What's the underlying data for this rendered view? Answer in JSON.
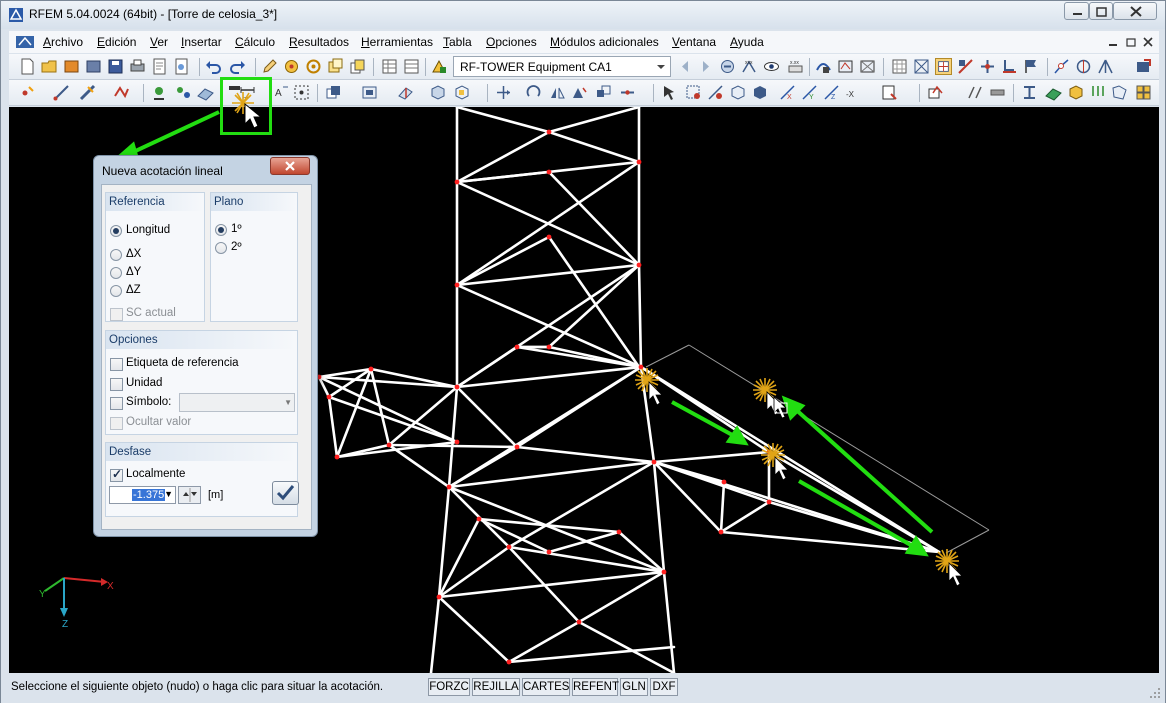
{
  "window": {
    "title": "RFEM 5.04.0024 (64bit) - [Torre de celosia_3*]"
  },
  "menu": {
    "items": [
      "Archivo",
      "Edición",
      "Ver",
      "Insertar",
      "Cálculo",
      "Resultados",
      "Herramientas",
      "Tabla",
      "Opciones",
      "Módulos adicionales",
      "Ventana",
      "Ayuda"
    ]
  },
  "toolbar": {
    "model_select_value": "RF-TOWER Equipment CA1"
  },
  "dialog": {
    "title": "Nueva acotación lineal",
    "close_icon": "close-x-icon",
    "referencia": {
      "heading": "Referencia",
      "options": [
        "Longitud",
        "ΔX",
        "ΔY",
        "ΔZ"
      ],
      "selected": "Longitud",
      "sc_actual_label": "SC actual"
    },
    "plano": {
      "heading": "Plano",
      "options": [
        "1º",
        "2º"
      ],
      "selected": "1º"
    },
    "opciones": {
      "heading": "Opciones",
      "etiqueta_label": "Etiqueta de referencia",
      "unidad_label": "Unidad",
      "simbolo_label": "Símbolo:",
      "ocultar_label": "Ocultar valor"
    },
    "desfase": {
      "heading": "Desfase",
      "localmente_label": "Localmente",
      "localmente_checked": true,
      "value": "-1.375",
      "unit": "[m]"
    }
  },
  "viewport": {
    "axes": {
      "x": "X",
      "y": "Y",
      "z": "Z"
    },
    "background": "#000000",
    "member_color": "#ffffff",
    "node_color": "#ff2020",
    "annotation_color": "#22dd11"
  },
  "status": {
    "message": "Seleccione el siguiente objeto (nudo) o haga clic para situar la acotación.",
    "buttons": [
      "FORZC",
      "REJILLA",
      "CARTES",
      "REFENT",
      "GLN",
      "DXF"
    ]
  }
}
